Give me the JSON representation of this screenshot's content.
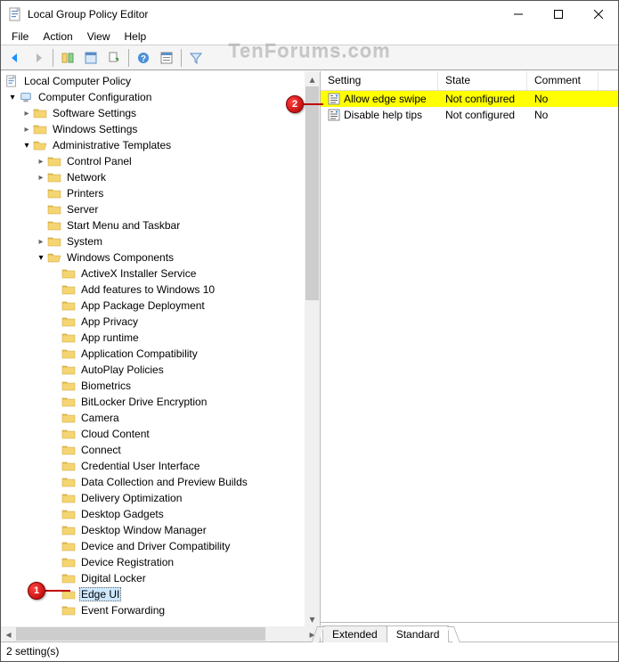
{
  "window": {
    "title": "Local Group Policy Editor"
  },
  "menu": {
    "items": [
      "File",
      "Action",
      "View",
      "Help"
    ]
  },
  "watermark": "TenForums.com",
  "tree": {
    "root": "Local Computer Policy",
    "cc": "Computer Configuration",
    "sw": "Software Settings",
    "ws": "Windows Settings",
    "at": "Administrative Templates",
    "at_children": [
      "Control Panel",
      "Network",
      "Printers",
      "Server",
      "Start Menu and Taskbar",
      "System"
    ],
    "wc": "Windows Components",
    "wc_children": [
      "ActiveX Installer Service",
      "Add features to Windows 10",
      "App Package Deployment",
      "App Privacy",
      "App runtime",
      "Application Compatibility",
      "AutoPlay Policies",
      "Biometrics",
      "BitLocker Drive Encryption",
      "Camera",
      "Cloud Content",
      "Connect",
      "Credential User Interface",
      "Data Collection and Preview Builds",
      "Delivery Optimization",
      "Desktop Gadgets",
      "Desktop Window Manager",
      "Device and Driver Compatibility",
      "Device Registration",
      "Digital Locker",
      "Edge UI",
      "Event Forwarding"
    ],
    "selected": "Edge UI"
  },
  "list": {
    "headers": {
      "setting": "Setting",
      "state": "State",
      "comment": "Comment"
    },
    "rows": [
      {
        "setting": "Allow edge swipe",
        "state": "Not configured",
        "comment": "No",
        "highlighted": true
      },
      {
        "setting": "Disable help tips",
        "state": "Not configured",
        "comment": "No",
        "highlighted": false
      }
    ]
  },
  "tabs": {
    "extended": "Extended",
    "standard": "Standard"
  },
  "status": "2 setting(s)",
  "markers": {
    "m1": "1",
    "m2": "2"
  }
}
